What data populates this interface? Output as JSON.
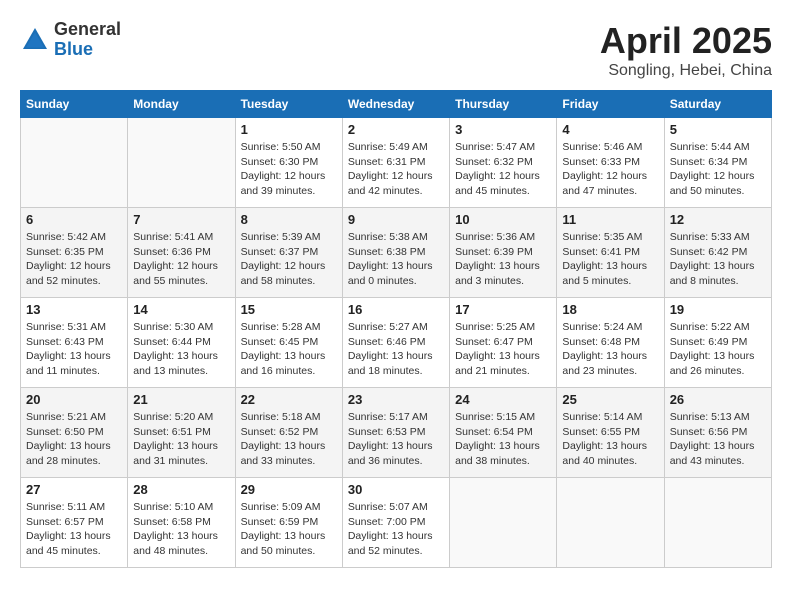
{
  "header": {
    "logo_general": "General",
    "logo_blue": "Blue",
    "month": "April 2025",
    "location": "Songling, Hebei, China"
  },
  "weekdays": [
    "Sunday",
    "Monday",
    "Tuesday",
    "Wednesday",
    "Thursday",
    "Friday",
    "Saturday"
  ],
  "weeks": [
    [
      {
        "day": "",
        "info": ""
      },
      {
        "day": "",
        "info": ""
      },
      {
        "day": "1",
        "info": "Sunrise: 5:50 AM\nSunset: 6:30 PM\nDaylight: 12 hours and 39 minutes."
      },
      {
        "day": "2",
        "info": "Sunrise: 5:49 AM\nSunset: 6:31 PM\nDaylight: 12 hours and 42 minutes."
      },
      {
        "day": "3",
        "info": "Sunrise: 5:47 AM\nSunset: 6:32 PM\nDaylight: 12 hours and 45 minutes."
      },
      {
        "day": "4",
        "info": "Sunrise: 5:46 AM\nSunset: 6:33 PM\nDaylight: 12 hours and 47 minutes."
      },
      {
        "day": "5",
        "info": "Sunrise: 5:44 AM\nSunset: 6:34 PM\nDaylight: 12 hours and 50 minutes."
      }
    ],
    [
      {
        "day": "6",
        "info": "Sunrise: 5:42 AM\nSunset: 6:35 PM\nDaylight: 12 hours and 52 minutes."
      },
      {
        "day": "7",
        "info": "Sunrise: 5:41 AM\nSunset: 6:36 PM\nDaylight: 12 hours and 55 minutes."
      },
      {
        "day": "8",
        "info": "Sunrise: 5:39 AM\nSunset: 6:37 PM\nDaylight: 12 hours and 58 minutes."
      },
      {
        "day": "9",
        "info": "Sunrise: 5:38 AM\nSunset: 6:38 PM\nDaylight: 13 hours and 0 minutes."
      },
      {
        "day": "10",
        "info": "Sunrise: 5:36 AM\nSunset: 6:39 PM\nDaylight: 13 hours and 3 minutes."
      },
      {
        "day": "11",
        "info": "Sunrise: 5:35 AM\nSunset: 6:41 PM\nDaylight: 13 hours and 5 minutes."
      },
      {
        "day": "12",
        "info": "Sunrise: 5:33 AM\nSunset: 6:42 PM\nDaylight: 13 hours and 8 minutes."
      }
    ],
    [
      {
        "day": "13",
        "info": "Sunrise: 5:31 AM\nSunset: 6:43 PM\nDaylight: 13 hours and 11 minutes."
      },
      {
        "day": "14",
        "info": "Sunrise: 5:30 AM\nSunset: 6:44 PM\nDaylight: 13 hours and 13 minutes."
      },
      {
        "day": "15",
        "info": "Sunrise: 5:28 AM\nSunset: 6:45 PM\nDaylight: 13 hours and 16 minutes."
      },
      {
        "day": "16",
        "info": "Sunrise: 5:27 AM\nSunset: 6:46 PM\nDaylight: 13 hours and 18 minutes."
      },
      {
        "day": "17",
        "info": "Sunrise: 5:25 AM\nSunset: 6:47 PM\nDaylight: 13 hours and 21 minutes."
      },
      {
        "day": "18",
        "info": "Sunrise: 5:24 AM\nSunset: 6:48 PM\nDaylight: 13 hours and 23 minutes."
      },
      {
        "day": "19",
        "info": "Sunrise: 5:22 AM\nSunset: 6:49 PM\nDaylight: 13 hours and 26 minutes."
      }
    ],
    [
      {
        "day": "20",
        "info": "Sunrise: 5:21 AM\nSunset: 6:50 PM\nDaylight: 13 hours and 28 minutes."
      },
      {
        "day": "21",
        "info": "Sunrise: 5:20 AM\nSunset: 6:51 PM\nDaylight: 13 hours and 31 minutes."
      },
      {
        "day": "22",
        "info": "Sunrise: 5:18 AM\nSunset: 6:52 PM\nDaylight: 13 hours and 33 minutes."
      },
      {
        "day": "23",
        "info": "Sunrise: 5:17 AM\nSunset: 6:53 PM\nDaylight: 13 hours and 36 minutes."
      },
      {
        "day": "24",
        "info": "Sunrise: 5:15 AM\nSunset: 6:54 PM\nDaylight: 13 hours and 38 minutes."
      },
      {
        "day": "25",
        "info": "Sunrise: 5:14 AM\nSunset: 6:55 PM\nDaylight: 13 hours and 40 minutes."
      },
      {
        "day": "26",
        "info": "Sunrise: 5:13 AM\nSunset: 6:56 PM\nDaylight: 13 hours and 43 minutes."
      }
    ],
    [
      {
        "day": "27",
        "info": "Sunrise: 5:11 AM\nSunset: 6:57 PM\nDaylight: 13 hours and 45 minutes."
      },
      {
        "day": "28",
        "info": "Sunrise: 5:10 AM\nSunset: 6:58 PM\nDaylight: 13 hours and 48 minutes."
      },
      {
        "day": "29",
        "info": "Sunrise: 5:09 AM\nSunset: 6:59 PM\nDaylight: 13 hours and 50 minutes."
      },
      {
        "day": "30",
        "info": "Sunrise: 5:07 AM\nSunset: 7:00 PM\nDaylight: 13 hours and 52 minutes."
      },
      {
        "day": "",
        "info": ""
      },
      {
        "day": "",
        "info": ""
      },
      {
        "day": "",
        "info": ""
      }
    ]
  ]
}
